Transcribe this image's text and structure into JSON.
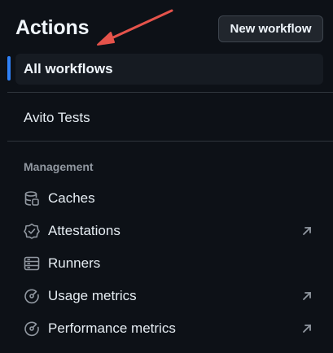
{
  "header": {
    "title": "Actions",
    "new_workflow_label": "New workflow"
  },
  "nav": {
    "active_label": "All workflows",
    "workflows": [
      "Avito Tests"
    ]
  },
  "management": {
    "heading": "Management",
    "items": [
      {
        "label": "Caches",
        "icon": "database-icon",
        "external": false
      },
      {
        "label": "Attestations",
        "icon": "shield-check-icon",
        "external": true
      },
      {
        "label": "Runners",
        "icon": "server-icon",
        "external": false
      },
      {
        "label": "Usage metrics",
        "icon": "meter-icon",
        "external": true
      },
      {
        "label": "Performance metrics",
        "icon": "meter-icon",
        "external": true
      }
    ]
  },
  "colors": {
    "accent": "#2f81f7",
    "annotation_arrow": "#e5534b",
    "background": "#0d1117"
  }
}
